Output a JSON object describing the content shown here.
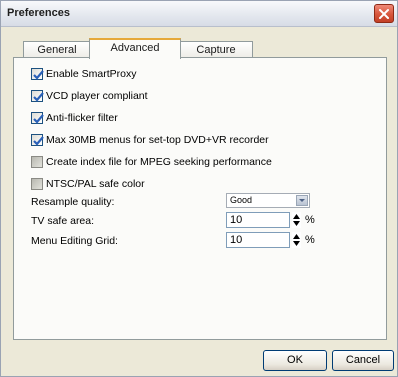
{
  "window": {
    "title": "Preferences"
  },
  "tabs": [
    {
      "label": "General",
      "active": false
    },
    {
      "label": "Advanced",
      "active": true
    },
    {
      "label": "Capture",
      "active": false
    }
  ],
  "options": [
    {
      "label": "Enable SmartProxy",
      "checked": true
    },
    {
      "label": "VCD player compliant",
      "checked": true
    },
    {
      "label": "Anti-flicker filter",
      "checked": true
    },
    {
      "label": "Max 30MB menus for set-top DVD+VR recorder",
      "checked": true
    },
    {
      "label": "Create index file for MPEG seeking performance",
      "checked": false
    },
    {
      "label": "NTSC/PAL safe color",
      "checked": false
    }
  ],
  "resample_quality": {
    "label": "Resample quality:",
    "value": "Good"
  },
  "tv_safe_area": {
    "label": "TV safe area:",
    "value": "10",
    "unit": "%"
  },
  "menu_editing_grid": {
    "label": "Menu Editing Grid:",
    "value": "10",
    "unit": "%"
  },
  "buttons": {
    "ok": "OK",
    "cancel": "Cancel"
  },
  "colors": {
    "dialog_bg": "#ece9d8",
    "panel_bg": "#fbfbf9",
    "check_accent": "#2a60b8",
    "tab_highlight": "#e6a93a",
    "close_button": "#d7553b"
  }
}
